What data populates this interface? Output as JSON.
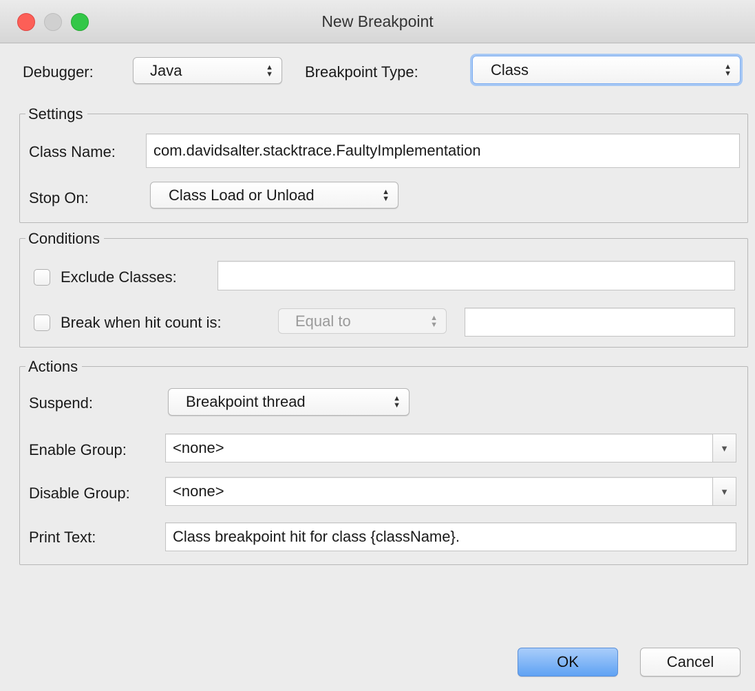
{
  "window": {
    "title": "New Breakpoint"
  },
  "top": {
    "debugger_label": "Debugger:",
    "debugger_value": "Java",
    "breakpoint_type_label": "Breakpoint Type:",
    "breakpoint_type_value": "Class"
  },
  "settings": {
    "title": "Settings",
    "class_name_label": "Class Name:",
    "class_name_value": "com.davidsalter.stacktrace.FaultyImplementation",
    "stop_on_label": "Stop On:",
    "stop_on_value": "Class Load or Unload"
  },
  "conditions": {
    "title": "Conditions",
    "exclude_classes_label": "Exclude Classes:",
    "exclude_classes_checked": false,
    "exclude_classes_value": "",
    "hit_count_label": "Break when hit count is:",
    "hit_count_checked": false,
    "hit_count_operator": "Equal to",
    "hit_count_value": ""
  },
  "actions": {
    "title": "Actions",
    "suspend_label": "Suspend:",
    "suspend_value": "Breakpoint thread",
    "enable_group_label": "Enable Group:",
    "enable_group_value": "<none>",
    "disable_group_label": "Disable Group:",
    "disable_group_value": "<none>",
    "print_text_label": "Print Text:",
    "print_text_value": "Class breakpoint hit for class {className}."
  },
  "buttons": {
    "ok": "OK",
    "cancel": "Cancel"
  },
  "icons": {
    "updown": "updown-arrows-icon",
    "dropdown": "dropdown-arrow-icon"
  },
  "colors": {
    "window_bg": "#ececec",
    "close": "#fc5f57",
    "minimize_disabled": "#d0d0d0",
    "zoom": "#33c748",
    "focus_ring": "#a7c8f4",
    "default_button": "#5fa2f3"
  }
}
